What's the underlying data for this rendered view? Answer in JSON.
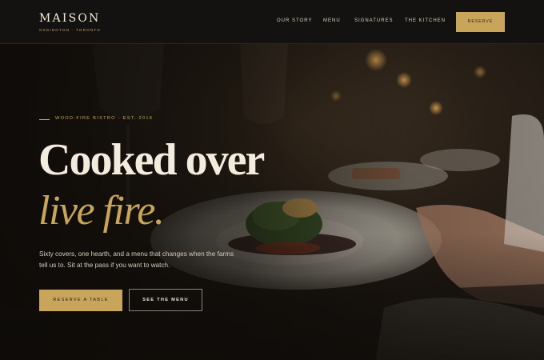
{
  "header": {
    "brand_name": "MAISON",
    "brand_sub": "OSSINGTON · TORONTO",
    "nav": [
      {
        "label": "OUR STORY"
      },
      {
        "label": "MENU"
      },
      {
        "label": "SIGNATURES"
      },
      {
        "label": "THE KITCHEN"
      }
    ],
    "reserve_label": "RESERVE"
  },
  "hero": {
    "eyebrow": "WOOD-FIRE BISTRO · EST. 2018",
    "headline": "Cooked over",
    "headline_accent": "live fire.",
    "lede": "Sixty covers, one hearth, and a menu that changes when the farms tell us to. Sit at the pass if you want to watch.",
    "cta_primary": "RESERVE A TABLE",
    "cta_secondary": "SEE THE MENU"
  },
  "colors": {
    "accent": "#c9a55c",
    "header_bg": "#141210",
    "text": "#efe7d8"
  }
}
